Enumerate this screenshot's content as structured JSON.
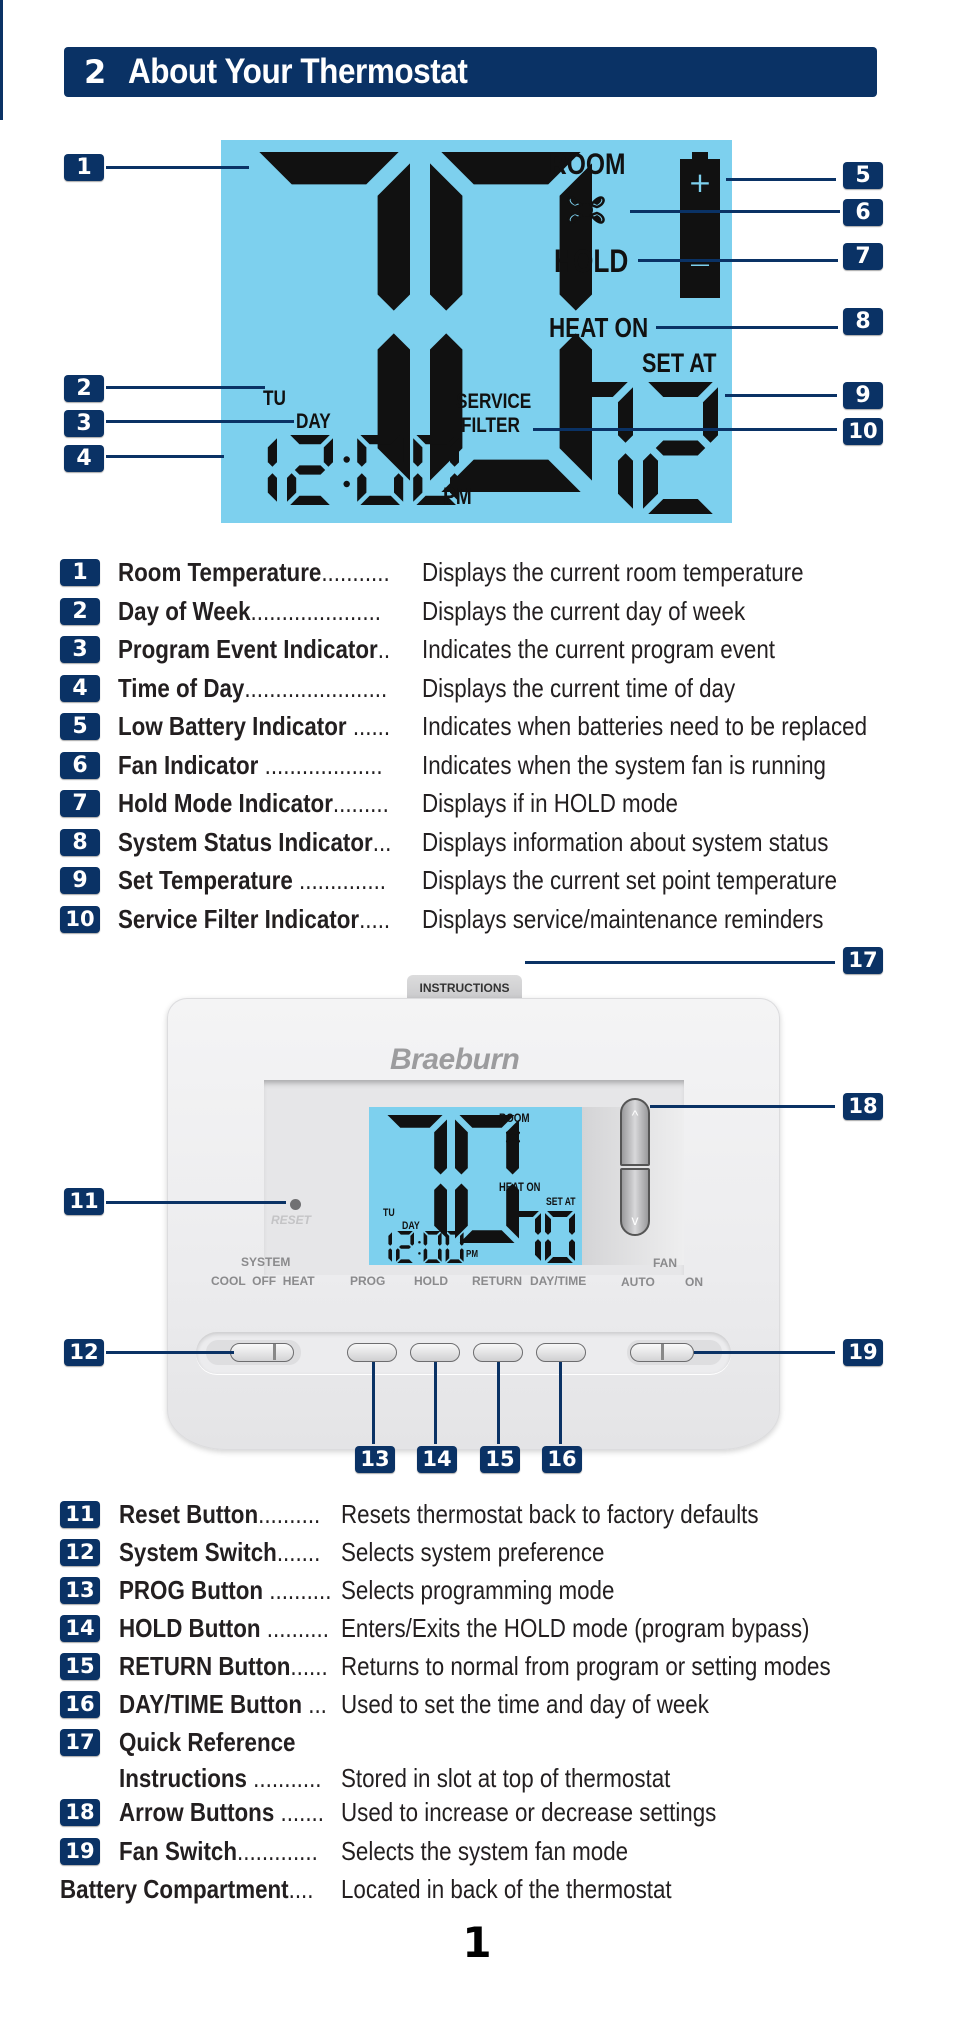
{
  "header": {
    "section_number": "2",
    "title": "About Your Thermostat"
  },
  "colors": {
    "brand_navy": "#0a3265",
    "lcd_blue": "#7dd0ee"
  },
  "main_display": {
    "room_temp": "70",
    "room_label": "ROOM",
    "fan_icon": "fan-icon",
    "hold_label": "HOLD",
    "battery_icon": "battery-icon",
    "battery_plus": "+",
    "battery_minus": "—",
    "heat_on_label": "HEAT ON",
    "set_at_label": "SET AT",
    "set_temp": "72",
    "day_label": "TU",
    "event_label": "DAY",
    "time": "12:00",
    "ampm": "PM",
    "service_line1": "SERVICE",
    "service_line2": "FILTER"
  },
  "display_callouts": [
    "1",
    "2",
    "3",
    "4",
    "5",
    "6",
    "7",
    "8",
    "9",
    "10"
  ],
  "display_legend": [
    {
      "num": "1",
      "label": "Room Temperature",
      "dots": "...........",
      "desc": "Displays the current room temperature"
    },
    {
      "num": "2",
      "label": "Day of Week",
      "dots": ".....................",
      "desc": "Displays the current day of week"
    },
    {
      "num": "3",
      "label": "Program Event Indicator",
      "dots": "..",
      "desc": "Indicates the current program event"
    },
    {
      "num": "4",
      "label": "Time of Day",
      "dots": ".......................",
      "desc": "Displays the current time of day"
    },
    {
      "num": "5",
      "label": "Low Battery Indicator",
      "dots": " ......",
      "desc": "Indicates when batteries need to be replaced"
    },
    {
      "num": "6",
      "label": "Fan Indicator",
      "dots": " ...................",
      "desc": "Indicates when the system fan is running"
    },
    {
      "num": "7",
      "label": "Hold Mode Indicator",
      "dots": ".........",
      "desc": "Displays if in HOLD mode"
    },
    {
      "num": "8",
      "label": "System Status Indicator",
      "dots": "...",
      "desc": "Displays information about system status"
    },
    {
      "num": "9",
      "label": "Set Temperature",
      "dots": " ..............",
      "desc": "Displays the current set point temperature"
    },
    {
      "num": "10",
      "label": "Service Filter Indicator",
      "dots": ".....",
      "desc": "Displays service/maintenance reminders"
    }
  ],
  "device": {
    "instructions_tab": "INSTRUCTIONS",
    "brand": "Braeburn",
    "reset_label": "RESET",
    "lcd": {
      "room_temp": "70",
      "room_label": "ROOM",
      "heat_on_label": "HEAT ON",
      "set_at_label": "SET AT",
      "set_temp": "70",
      "day_label": "TU",
      "event_label": "DAY",
      "time": "12:00",
      "ampm": "PM"
    },
    "arrow_up": "^",
    "arrow_down": "v",
    "system_switch": {
      "title": "SYSTEM",
      "options": "COOL  OFF  HEAT",
      "selected": "HEAT"
    },
    "buttons": [
      "PROG",
      "HOLD",
      "RETURN",
      "DAY/TIME"
    ],
    "fan_switch": {
      "title": "FAN",
      "option_auto": "AUTO",
      "option_on": "ON",
      "selected": "ON"
    }
  },
  "device_callouts": [
    "11",
    "12",
    "13",
    "14",
    "15",
    "16",
    "17",
    "18",
    "19"
  ],
  "device_legend": [
    {
      "num": "11",
      "label": "Reset Button",
      "dots": "..........",
      "desc": "Resets thermostat back to factory defaults"
    },
    {
      "num": "12",
      "label": "System Switch",
      "dots": ".......",
      "desc": "Selects system preference"
    },
    {
      "num": "13",
      "label": "PROG Button",
      "dots": " ..........",
      "desc": "Selects programming mode"
    },
    {
      "num": "14",
      "label": "HOLD Button",
      "dots": " ..........",
      "desc": "Enters/Exits the HOLD mode (program bypass)"
    },
    {
      "num": "15",
      "label": "RETURN Button",
      "dots": "......",
      "desc": "Returns to normal from program or setting modes"
    },
    {
      "num": "16",
      "label": "DAY/TIME Button",
      "dots": " ...",
      "desc": "Used to set the time and day of week"
    },
    {
      "num": "17",
      "label": "Quick Reference",
      "dots": "",
      "desc": ""
    },
    {
      "num": "",
      "label": "Instructions",
      "dots": " ...........",
      "desc": " Stored in slot at top of thermostat"
    },
    {
      "num": "18",
      "label": "Arrow Buttons",
      "dots": " .......",
      "desc": " Used to increase or decrease settings"
    },
    {
      "num": "19",
      "label": "Fan Switch",
      "dots": ".............",
      "desc": "Selects the system fan mode"
    },
    {
      "num": "",
      "label": "Battery Compartment",
      "dots": "....",
      "desc": "Located in back of the thermostat"
    }
  ],
  "page_number": "1"
}
